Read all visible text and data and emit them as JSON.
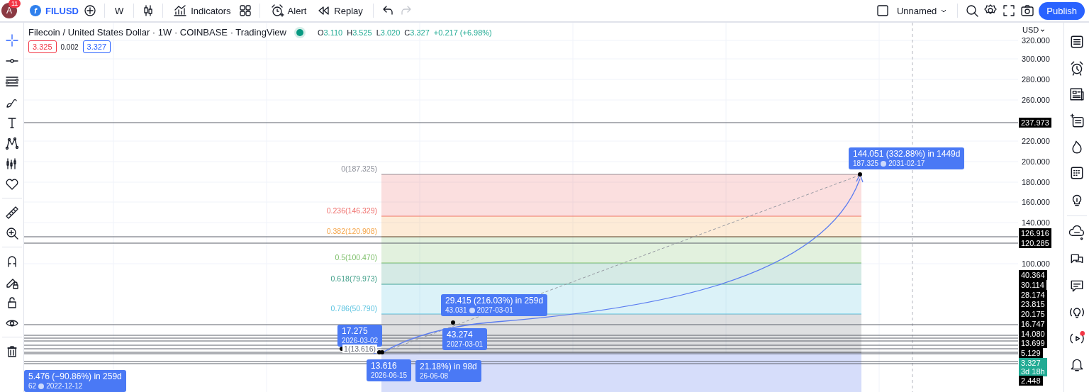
{
  "toolbar": {
    "avatar": "A",
    "notifications": "11",
    "logo_letter": "f",
    "symbol": "FILUSD",
    "interval": "W",
    "indicators": "Indicators",
    "alert": "Alert",
    "replay": "Replay",
    "undo": {
      "disabled": false
    },
    "redo": {
      "disabled": true
    },
    "layout_name": "Unnamed",
    "publish": "Publish"
  },
  "legend": {
    "title": "Filecoin / United States Dollar · 1W · COINBASE · TradingView",
    "ohlc": [
      {
        "label": "O",
        "value": "3.110"
      },
      {
        "label": "H",
        "value": "3.525"
      },
      {
        "label": "L",
        "value": "3.020"
      },
      {
        "label": "C",
        "value": "3.327"
      }
    ],
    "change": "+0.217 (+6.98%)",
    "bid": "3.325",
    "spread": "0.002",
    "ask": "3.327"
  },
  "fib": {
    "levels": [
      {
        "label": "0(187.325)",
        "color": "#8c8f99"
      },
      {
        "label": "0.236(146.329)",
        "color": "#ef6f6c"
      },
      {
        "label": "0.382(120.908)",
        "color": "#f5a54a"
      },
      {
        "label": "0.5(100.470)",
        "color": "#7dbf6a"
      },
      {
        "label": "0.618(79.973)",
        "color": "#3f9e88"
      },
      {
        "label": "0.786(50.790)",
        "color": "#5bc3e0"
      },
      {
        "label": "1(13.616)",
        "color": "#6a6d78"
      }
    ]
  },
  "callouts": [
    {
      "title": "144.051 (332.88%) in 1449d",
      "price": "187.325",
      "date": "2031-02-17"
    },
    {
      "title": "29.415 (216.03%) in 259d",
      "price": "43.031",
      "date": "2027-03-01"
    },
    {
      "title": "17.275",
      "date": "2026-03-02"
    },
    {
      "title": "43.274",
      "date": "2027-03-01"
    },
    {
      "title": "13.616",
      "date": "2026-06-15"
    },
    {
      "title": "21.18%) in 98d",
      "date": "26-06-08"
    },
    {
      "title": "5.476 (−90.86%) in 259d",
      "price": "62",
      "date": "2022-12-12"
    }
  ],
  "price_axis": {
    "currency": "USD",
    "labels": [
      {
        "text": "320.000",
        "kind": "tick"
      },
      {
        "text": "300.000",
        "kind": "tick"
      },
      {
        "text": "280.000",
        "kind": "tick"
      },
      {
        "text": "260.000",
        "kind": "tick"
      },
      {
        "text": "237.973",
        "kind": "marker"
      },
      {
        "text": "220.000",
        "kind": "tick"
      },
      {
        "text": "200.000",
        "kind": "tick"
      },
      {
        "text": "180.000",
        "kind": "tick"
      },
      {
        "text": "160.000",
        "kind": "tick"
      },
      {
        "text": "140.000",
        "kind": "tick"
      },
      {
        "text": "126.916",
        "kind": "marker"
      },
      {
        "text": "120.285",
        "kind": "marker"
      },
      {
        "text": "100.000",
        "kind": "tick"
      },
      {
        "text": "40.364",
        "kind": "marker"
      },
      {
        "text": "30.114",
        "kind": "marker"
      },
      {
        "text": "28.174",
        "kind": "marker"
      },
      {
        "text": "23.815",
        "kind": "marker"
      },
      {
        "text": "20.175",
        "kind": "marker"
      },
      {
        "text": "16.747",
        "kind": "marker"
      },
      {
        "text": "14.080",
        "kind": "marker"
      },
      {
        "text": "13.699",
        "kind": "marker"
      },
      {
        "text": "5.129",
        "kind": "marker"
      },
      {
        "text": "3.327",
        "sub": "3d 18h",
        "kind": "last"
      },
      {
        "text": "2.448",
        "kind": "marker"
      }
    ]
  }
}
